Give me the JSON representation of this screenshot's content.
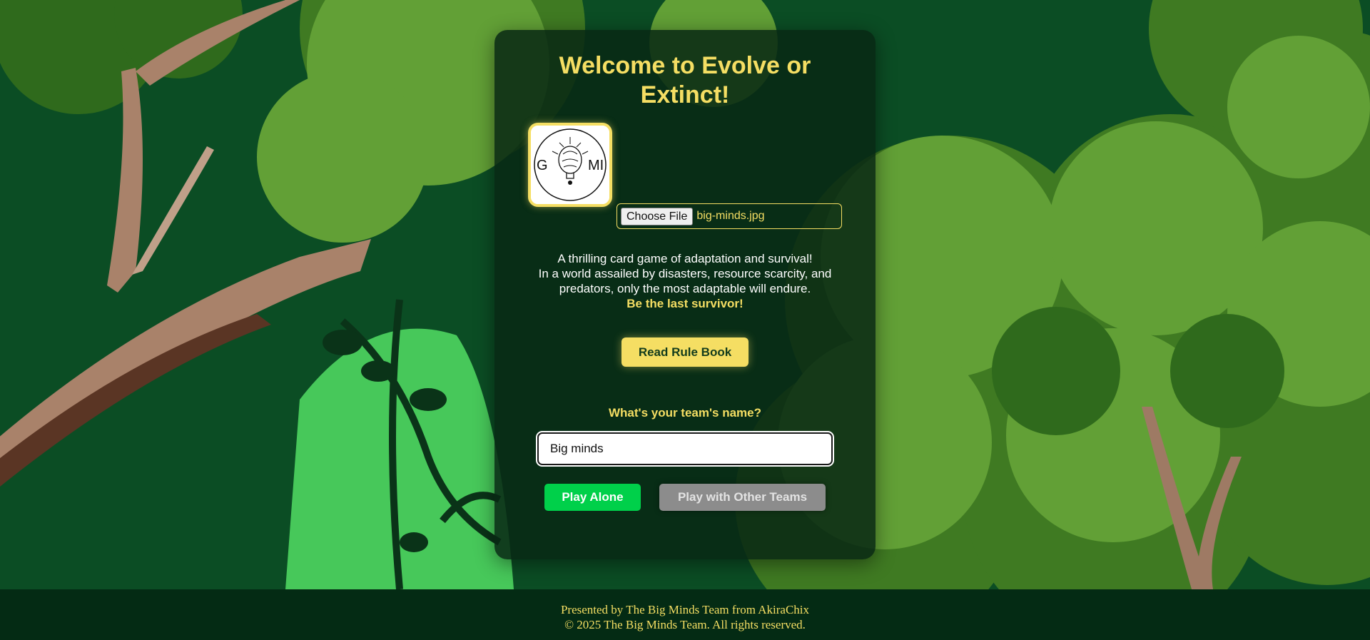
{
  "colors": {
    "accent_yellow": "#f5de63",
    "card_bg": "#082814",
    "play_alone_green": "#00d04a",
    "disabled_grey": "#8c8c8c",
    "footer_bg": "#042b14",
    "forest_dark": "#0a4a22"
  },
  "background": {
    "icon": "jungle-scene-illustration"
  },
  "card": {
    "title": "Welcome to Evolve or Extinct!",
    "logo": {
      "icon": "big-minds-logo",
      "text": "BIG MINDS"
    },
    "file_input": {
      "button_label": "Choose File",
      "file_name": "big-minds.jpg"
    },
    "description": {
      "line1": "A thrilling card game of adaptation and survival!",
      "line2": "In a world assailed by disasters, resource scarcity, and predators, only the most adaptable will endure.",
      "tagline": "Be the last survivor!"
    },
    "rule_book_button": "Read Rule Book",
    "team_prompt": "What's your team's name?",
    "team_input_value": "Big minds",
    "play_alone_button": "Play Alone",
    "play_others_button": "Play with Other Teams"
  },
  "footer": {
    "line1": "Presented by The Big Minds Team from AkiraChix",
    "line2": "© 2025 The Big Minds Team. All rights reserved."
  }
}
